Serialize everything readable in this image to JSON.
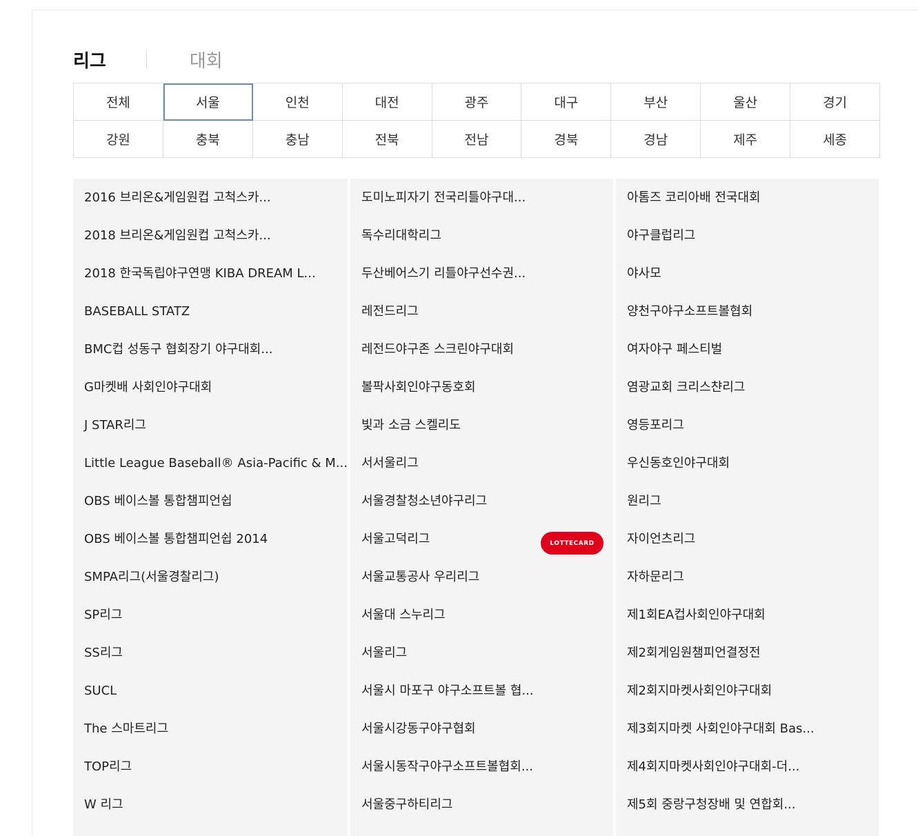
{
  "tabs": {
    "league": "리그",
    "tournament": "대회"
  },
  "regions": [
    "전체",
    "서울",
    "인천",
    "대전",
    "광주",
    "대구",
    "부산",
    "울산",
    "경기",
    "강원",
    "충북",
    "충남",
    "전북",
    "전남",
    "경북",
    "경남",
    "제주",
    "세종"
  ],
  "selected_region": "서울",
  "columns": [
    [
      "2016 브리온&게임원컵 고척스카...",
      "2018 브리온&게임원컵 고척스카...",
      "2018 한국독립야구연맹 KIBA DREAM L...",
      "BASEBALL STATZ",
      "BMC컵 성동구 협회장기 야구대회...",
      "G마켓배 사회인야구대회",
      "J STAR리그",
      "Little League Baseball® Asia-Pacific & M...",
      "OBS 베이스볼 통합챔피언쉽",
      "OBS 베이스볼 통합챔피언쉽 2014",
      "SMPA리그(서울경찰리그)",
      "SP리그",
      "SS리그",
      "SUCL",
      "The 스마트리그",
      "TOP리그",
      "W 리그"
    ],
    [
      "도미노피자기 전국리틀야구대...",
      "독수리대학리그",
      "두산베어스기 리틀야구선수권...",
      "레전드리그",
      "레전드야구존 스크린야구대회",
      "볼팍사회인야구동호회",
      "빛과 소금 스켈리도",
      "서서울리그",
      "서울경찰청소년야구리그",
      "서울고덕리그",
      "서울교통공사 우리리그",
      "서울대 스누리그",
      "서울리그",
      "서울시 마포구 야구소프트볼 협...",
      "서울시강동구야구협회",
      "서울시동작구야구소프트볼협회...",
      "서울중구하티리그"
    ],
    [
      "아톰즈 코리아배 전국대회",
      "야구클럽리그",
      "야사모",
      "양천구야구소프트볼협회",
      "여자야구 페스티벌",
      "염광교회 크리스챤리그",
      "영등포리그",
      "우신동호인야구대회",
      "원리그",
      "자이언츠리그",
      "자하문리그",
      "제1회EA컵사회인야구대회",
      "제2회게임원챔피언결정전",
      "제2회지마켓사회인야구대회",
      "제3회지마켓 사회인야구대회 Bas...",
      "제4회지마켓사회인야구대회-더...",
      "제5회 중랑구청장배 및 연합회..."
    ]
  ],
  "ad_badge": {
    "text": "LOTTECARD",
    "color": "#e0001b"
  }
}
